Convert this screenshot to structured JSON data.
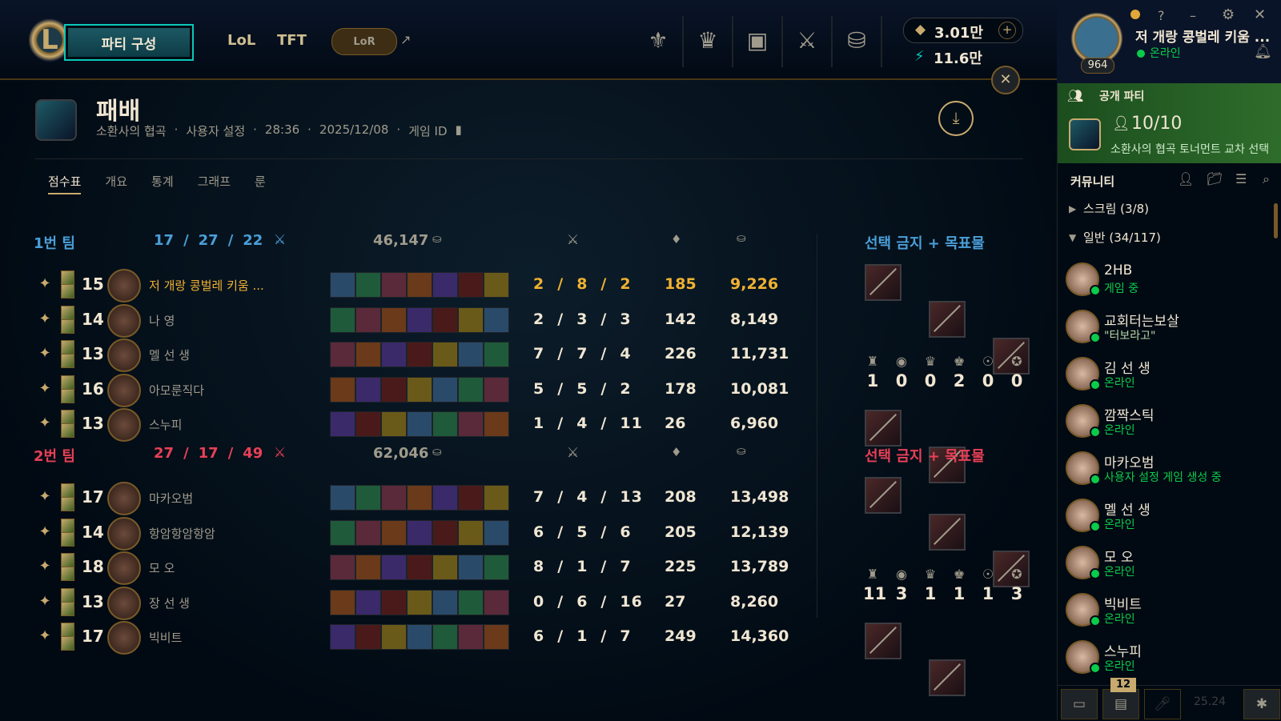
{
  "nav": {
    "logo_letter": "L",
    "play_label": "파티 구성",
    "tabs": [
      "LoL",
      "TFT"
    ],
    "lor_label": "LoR",
    "external_icon": "↗",
    "icons": [
      "trophy-icon",
      "ranked-icon",
      "loot-icon",
      "collection-icon",
      "store-icon"
    ]
  },
  "currency": {
    "rp": "3.01만",
    "be": "11.6만"
  },
  "profile": {
    "name": "저 개랑 콩벌레 키움 ...",
    "status": "온라인",
    "level": "964",
    "buttons": [
      "?",
      "–",
      "⚙",
      "✕"
    ]
  },
  "match": {
    "result": "패배",
    "mode": "소환사의 협곡",
    "type": "사용자 설정",
    "duration": "28:36",
    "date": "2025/12/08",
    "game_id_label": "게임 ID",
    "tabs": [
      "점수표",
      "개요",
      "통계",
      "그래프",
      "룬"
    ],
    "active_tab": 0
  },
  "team1": {
    "label": "1번 팀",
    "k": "17",
    "d": "27",
    "a": "22",
    "gold": "46,147",
    "bans_label": "선택 금지 + 목표물",
    "objectives": [
      "1",
      "0",
      "0",
      "2",
      "0",
      "0"
    ],
    "players": [
      {
        "level": "15",
        "name": "저 개랑 콩벌레 키움 ...",
        "highlight": true,
        "k": "2",
        "d": "8",
        "a": "2",
        "cs": "185",
        "gold": "9,226"
      },
      {
        "level": "14",
        "name": "나 영",
        "k": "2",
        "d": "3",
        "a": "3",
        "cs": "142",
        "gold": "8,149"
      },
      {
        "level": "13",
        "name": "멜 선 생",
        "k": "7",
        "d": "7",
        "a": "4",
        "cs": "226",
        "gold": "11,731"
      },
      {
        "level": "16",
        "name": "아모룬직다",
        "k": "5",
        "d": "5",
        "a": "2",
        "cs": "178",
        "gold": "10,081"
      },
      {
        "level": "13",
        "name": "스누피",
        "k": "1",
        "d": "4",
        "a": "11",
        "cs": "26",
        "gold": "6,960"
      }
    ]
  },
  "team2": {
    "label": "2번 팀",
    "k": "27",
    "d": "17",
    "a": "49",
    "gold": "62,046",
    "bans_label": "선택 금지 + 목표물",
    "objectives": [
      "11",
      "3",
      "1",
      "1",
      "1",
      "3"
    ],
    "players": [
      {
        "level": "17",
        "name": "마카오범",
        "k": "7",
        "d": "4",
        "a": "13",
        "cs": "208",
        "gold": "13,498"
      },
      {
        "level": "14",
        "name": "항암항암항암",
        "k": "6",
        "d": "5",
        "a": "6",
        "cs": "205",
        "gold": "12,139"
      },
      {
        "level": "18",
        "name": "모 오",
        "k": "8",
        "d": "1",
        "a": "7",
        "cs": "225",
        "gold": "13,789"
      },
      {
        "level": "13",
        "name": "장 선 생",
        "k": "0",
        "d": "6",
        "a": "16",
        "cs": "27",
        "gold": "8,260"
      },
      {
        "level": "17",
        "name": "빅비트",
        "k": "6",
        "d": "1",
        "a": "7",
        "cs": "249",
        "gold": "14,360"
      }
    ]
  },
  "sidebar": {
    "party_label": "공개 파티",
    "party_count": "10/10",
    "party_desc": "소환사의 협곡 토너먼트 교차 선택",
    "community_label": "커뮤니티",
    "groups": [
      {
        "label": "스크림 (3/8)",
        "open": false
      },
      {
        "label": "일반 (34/117)",
        "open": true
      }
    ],
    "friends": [
      {
        "name": "2HB",
        "status": "게임 중"
      },
      {
        "name": "교회터는보살",
        "status": "\"터보라고\""
      },
      {
        "name": "김 선 생",
        "status": "온라인"
      },
      {
        "name": "깜짝스틱",
        "status": "온라인"
      },
      {
        "name": "마카오범",
        "status": "사용자 설정 게임 생성 중"
      },
      {
        "name": "멜 선 생",
        "status": "온라인"
      },
      {
        "name": "모 오",
        "status": "온라인"
      },
      {
        "name": "빅비트",
        "status": "온라인"
      },
      {
        "name": "스누피",
        "status": "온라인"
      }
    ],
    "bottom": {
      "badge": "12",
      "version": "25.24"
    }
  },
  "colors": {
    "gold": "#c8aa6e",
    "team1": "#4a9fd8",
    "team2": "#e84057",
    "highlight": "#f0b232",
    "online": "#0acb4a"
  }
}
